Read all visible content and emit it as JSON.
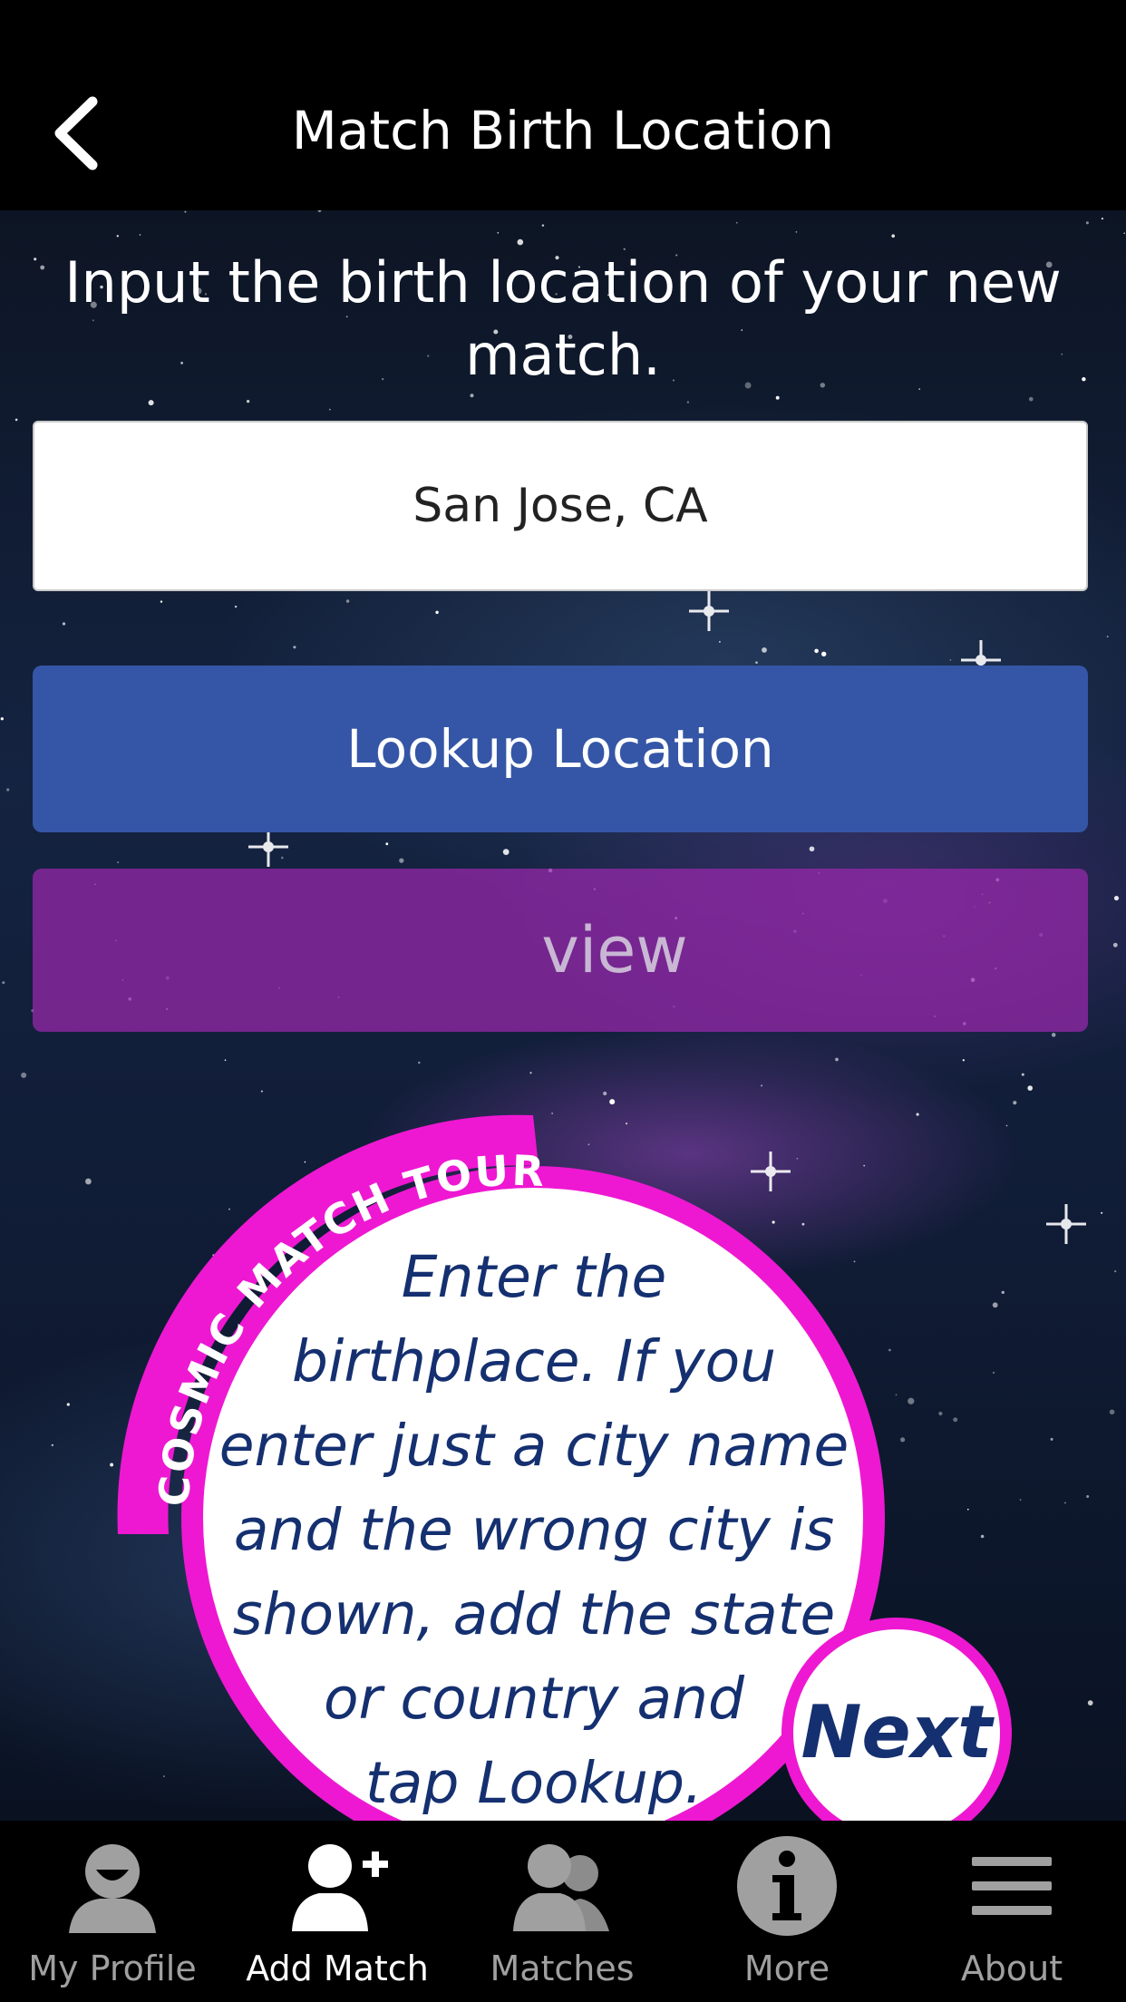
{
  "header": {
    "title": "Match Birth Location"
  },
  "main": {
    "prompt": "Input the birth location of your new match.",
    "location_value": "San Jose, CA",
    "lookup_label": "Lookup Location",
    "preview_label": "view"
  },
  "tour": {
    "ribbon": "COSMIC MATCH TOUR",
    "lines": [
      "Enter the",
      "birthplace. If you",
      "enter just a city name",
      "and the wrong city is",
      "shown, add the state",
      "or country and",
      "tap Lookup."
    ],
    "next_label": "Next",
    "accent": "#ee18d2",
    "text_color": "#153070"
  },
  "tabs": [
    {
      "label": "My Profile",
      "icon": "profile-icon"
    },
    {
      "label": "Add Match",
      "icon": "add-match-icon",
      "active": true
    },
    {
      "label": "Matches",
      "icon": "matches-icon"
    },
    {
      "label": "More",
      "icon": "info-icon"
    },
    {
      "label": "About",
      "icon": "menu-icon"
    }
  ]
}
